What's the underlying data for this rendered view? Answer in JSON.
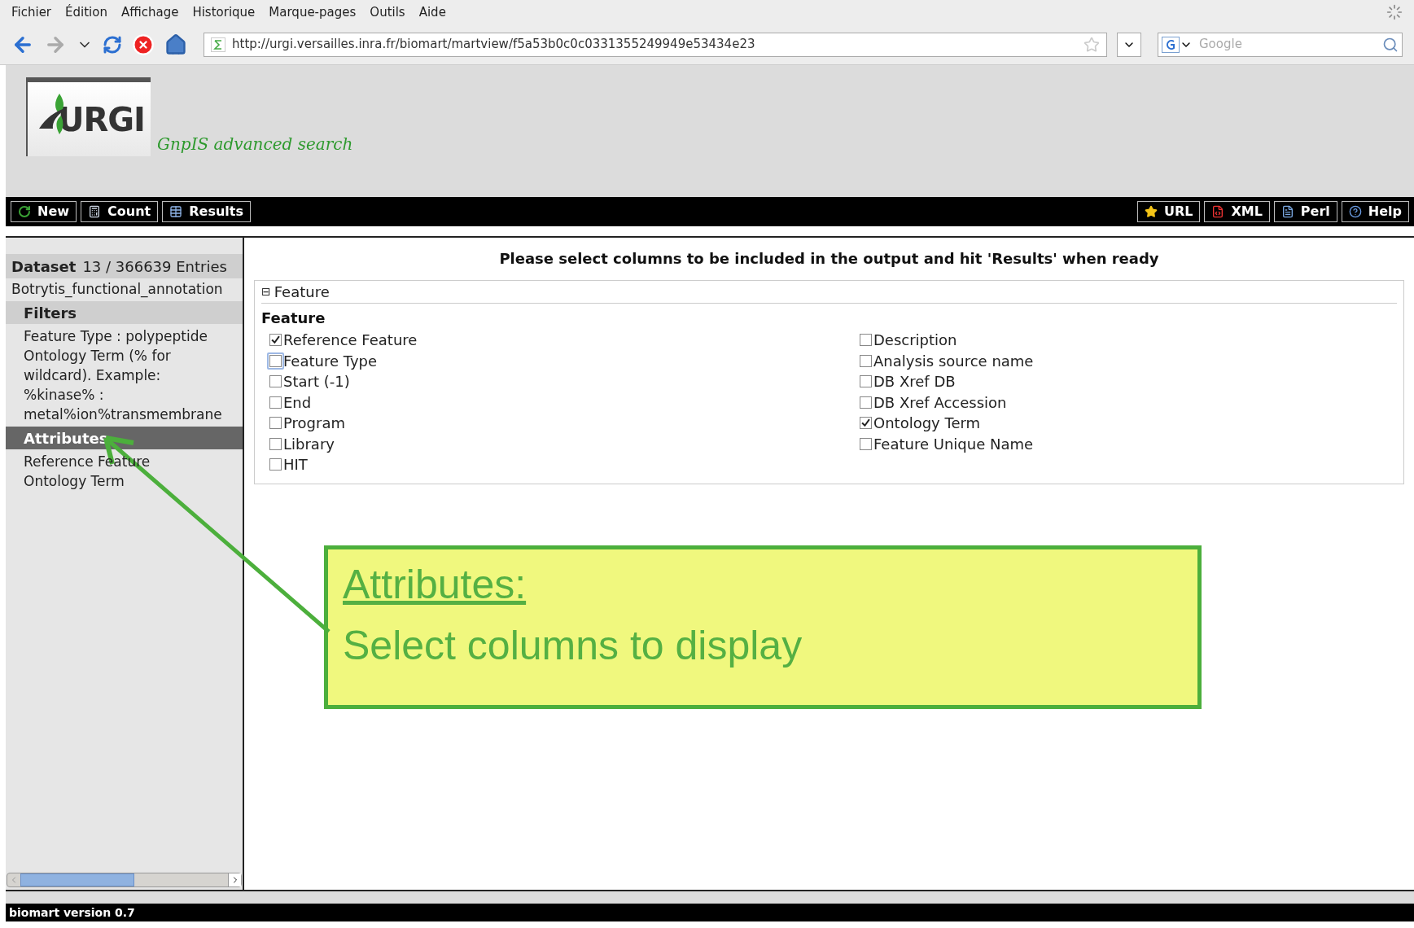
{
  "browser": {
    "menu": [
      "Fichier",
      "Édition",
      "Affichage",
      "Historique",
      "Marque-pages",
      "Outils",
      "Aide"
    ],
    "url": "http://urgi.versailles.inra.fr/biomart/martview/f5a53b0c0c0331355249949e53434e23",
    "search_placeholder": "Google"
  },
  "header": {
    "logo_text": "URGI",
    "subtitle": "GnpIS advanced search"
  },
  "toolbar": {
    "left": [
      {
        "label": "New",
        "kind": "new"
      },
      {
        "label": "Count",
        "kind": "count"
      },
      {
        "label": "Results",
        "kind": "results"
      }
    ],
    "right": [
      {
        "label": "URL",
        "kind": "url"
      },
      {
        "label": "XML",
        "kind": "xml"
      },
      {
        "label": "Perl",
        "kind": "perl"
      },
      {
        "label": "Help",
        "kind": "help"
      }
    ]
  },
  "sidebar": {
    "dataset_label": "Dataset",
    "dataset_count": "13 / 366639 Entries",
    "dataset_name": "Botrytis_functional_annotation",
    "sections": [
      {
        "title": "Filters",
        "selected": false,
        "items": [
          "Feature Type : polypeptide",
          "Ontology Term (% for wildcard). Example: %kinase% : metal%ion%transmembrane"
        ]
      },
      {
        "title": "Attributes",
        "selected": true,
        "items": [
          "Reference Feature",
          "Ontology Term"
        ]
      }
    ]
  },
  "main": {
    "instruction": "Please select columns to be included in the output and hit 'Results' when ready",
    "fieldset": {
      "toggle": "⊟",
      "legend": "Feature",
      "group_title": "Feature",
      "columns": [
        [
          {
            "label": "Reference Feature",
            "checked": true,
            "focused": false
          },
          {
            "label": "Feature Type",
            "checked": false,
            "focused": true
          },
          {
            "label": "Start (-1)",
            "checked": false,
            "focused": false
          },
          {
            "label": "End",
            "checked": false,
            "focused": false
          },
          {
            "label": "Program",
            "checked": false,
            "focused": false
          },
          {
            "label": "Library",
            "checked": false,
            "focused": false
          },
          {
            "label": "HIT",
            "checked": false,
            "focused": false
          }
        ],
        [
          {
            "label": "Description",
            "checked": false,
            "focused": false
          },
          {
            "label": "Analysis source name",
            "checked": false,
            "focused": false
          },
          {
            "label": "DB Xref DB",
            "checked": false,
            "focused": false
          },
          {
            "label": "DB Xref Accession",
            "checked": false,
            "focused": false
          },
          {
            "label": "Ontology Term",
            "checked": true,
            "focused": false
          },
          {
            "label": "Feature Unique Name",
            "checked": false,
            "focused": false
          }
        ]
      ]
    }
  },
  "callout": {
    "title": "Attributes:",
    "body": "Select columns to display"
  },
  "footer": {
    "version": "biomart version 0.7"
  }
}
